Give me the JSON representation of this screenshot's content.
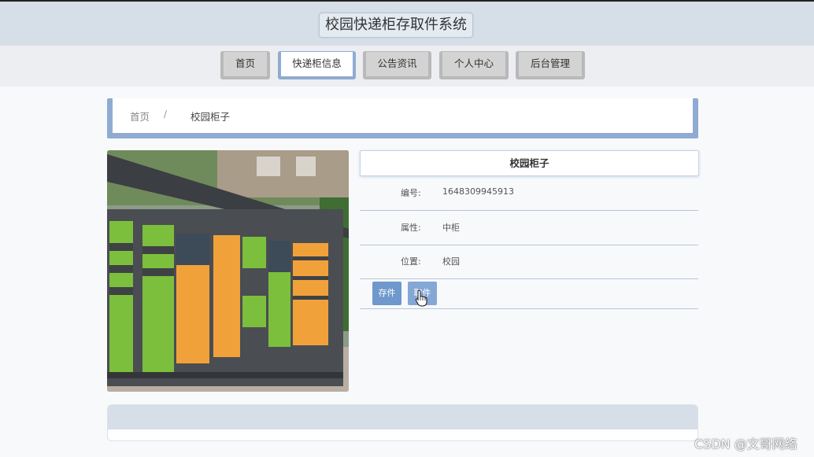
{
  "header": {
    "title": "校园快递柜存取件系统"
  },
  "nav": {
    "items": [
      {
        "label": "首页",
        "active": false
      },
      {
        "label": "快递柜信息",
        "active": true
      },
      {
        "label": "公告资讯",
        "active": false
      },
      {
        "label": "个人中心",
        "active": false
      },
      {
        "label": "后台管理",
        "active": false
      }
    ]
  },
  "breadcrumb": {
    "home": "首页",
    "separator": "/",
    "current": "校园柜子"
  },
  "detail": {
    "title": "校园柜子",
    "fields": [
      {
        "label": "编号:",
        "value": "1648309945913"
      },
      {
        "label": "属性:",
        "value": "中柜"
      },
      {
        "label": "位置:",
        "value": "校园"
      }
    ],
    "actions": {
      "store": "存件",
      "pickup": "取件"
    }
  },
  "watermark": "CSDN @文哥网络",
  "colors": {
    "accent": "#8fabd2",
    "button": "#6f98cc",
    "header_bg": "#d6dee8"
  }
}
